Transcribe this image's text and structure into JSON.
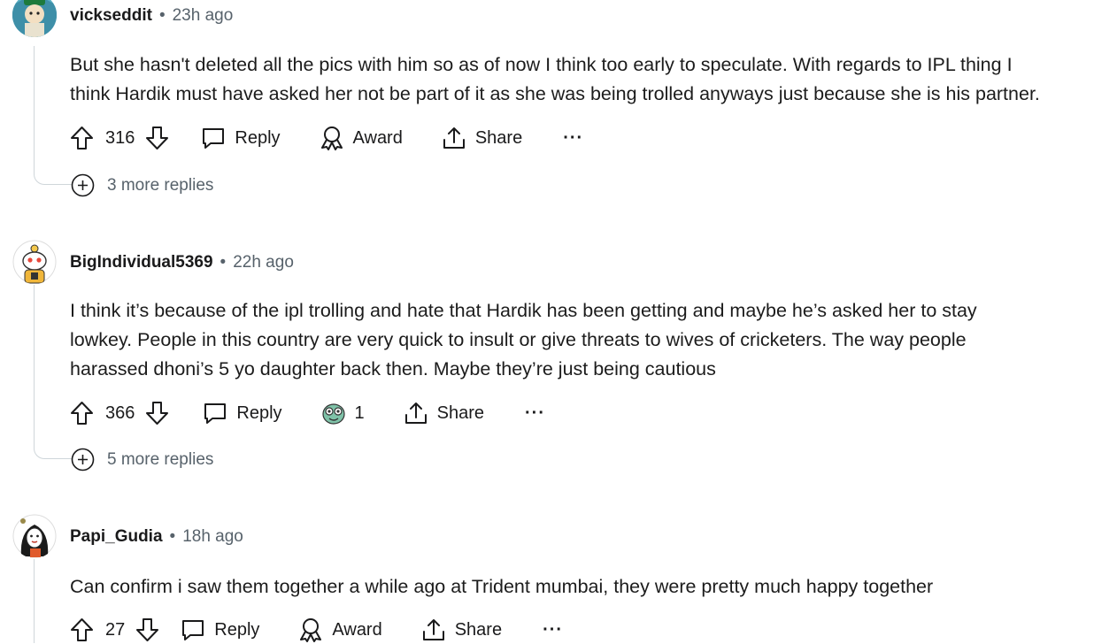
{
  "comments": [
    {
      "username": "vickseddit",
      "time": "23h ago",
      "body": [
        "But she hasn't deleted all the pics with him so as of now I think too early to speculate. With regards to IPL thing I",
        "think Hardik must have asked her not be part of it as she was being trolled anyways just because she is his partner."
      ],
      "votes": "316",
      "reply_label": "Reply",
      "award_label": "Award",
      "share_label": "Share",
      "more_replies": "3 more replies"
    },
    {
      "username": "BigIndividual5369",
      "time": "22h ago",
      "body": [
        "I think it’s because of the ipl trolling and hate that Hardik has been getting and maybe he’s asked her to stay",
        "lowkey. People in this country are very quick to insult or give threats to wives of cricketers. The way people",
        "harassed dhoni’s 5 yo daughter back then. Maybe they’re just being cautious"
      ],
      "votes": "366",
      "reply_label": "Reply",
      "award_count": "1",
      "share_label": "Share",
      "more_replies": "5 more replies"
    },
    {
      "username": "Papi_Gudia",
      "time": "18h ago",
      "body": [
        "Can confirm i saw them together a while ago at Trident mumbai, they were pretty much happy together"
      ],
      "votes": "27",
      "reply_label": "Reply",
      "award_label": "Award",
      "share_label": "Share"
    }
  ],
  "separator": "•",
  "more_icon": "···",
  "colors": {
    "text": "#1a1a1b",
    "meta": "#57626b",
    "thread": "#cfd6da"
  }
}
